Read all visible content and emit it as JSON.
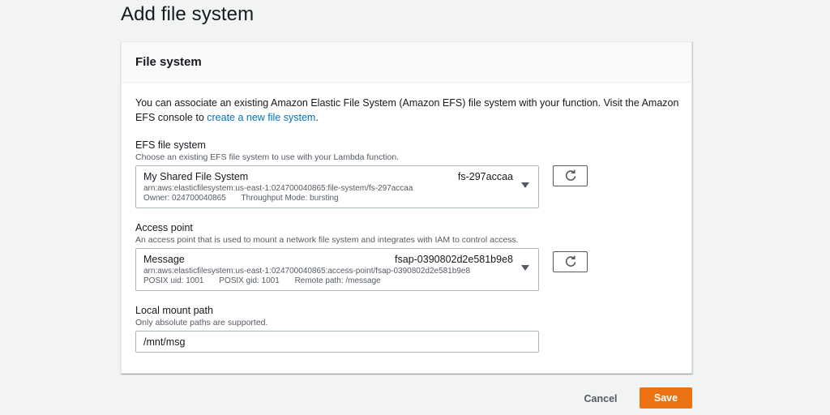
{
  "page": {
    "title": "Add file system"
  },
  "panel": {
    "title": "File system",
    "intro_text": "You can associate an existing Amazon Elastic File System (Amazon EFS) file system with your function. Visit the Amazon EFS console to ",
    "intro_link": "create a new file system",
    "intro_end": "."
  },
  "efs": {
    "label": "EFS file system",
    "description": "Choose an existing EFS file system to use with your Lambda function.",
    "selected": {
      "name": "My Shared File System",
      "id": "fs-297accaa",
      "arn": "arn:aws:elasticfilesystem:us-east-1:024700040865:file-system/fs-297accaa",
      "owner": "Owner: 024700040865",
      "throughput": "Throughput Mode: bursting"
    },
    "refresh_icon": "refresh-icon"
  },
  "access_point": {
    "label": "Access point",
    "description": "An access point that is used to mount a network file system and integrates with IAM to control access.",
    "selected": {
      "name": "Message",
      "id": "fsap-0390802d2e581b9e8",
      "arn": "arn:aws:elasticfilesystem:us-east-1:024700040865:access-point/fsap-0390802d2e581b9e8",
      "uid": "POSIX uid: 1001",
      "gid": "POSIX gid: 1001",
      "path": "Remote path: /message"
    },
    "refresh_icon": "refresh-icon"
  },
  "mount": {
    "label": "Local mount path",
    "description": "Only absolute paths are supported.",
    "value": "/mnt/msg"
  },
  "footer": {
    "cancel_label": "Cancel",
    "save_label": "Save"
  },
  "colors": {
    "primary": "#ec7211",
    "link": "#0073bb",
    "background": "#f2f3f3"
  }
}
